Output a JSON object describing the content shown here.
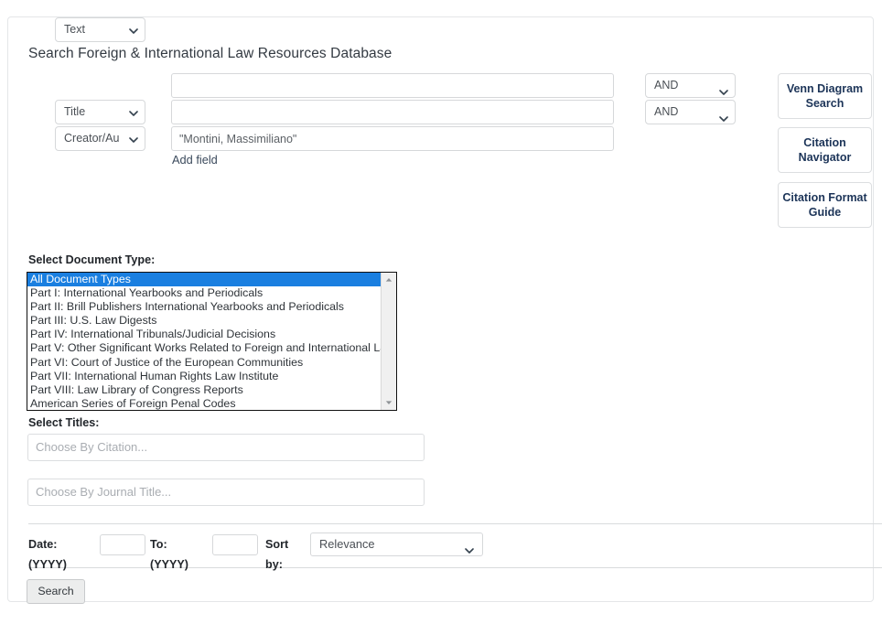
{
  "page": {
    "title": "Search Foreign & International Law Resources Database"
  },
  "search_rows": [
    {
      "field_label": "Text",
      "value": "",
      "boolean_label": "AND"
    },
    {
      "field_label": "Title",
      "value": "",
      "boolean_label": "AND"
    },
    {
      "field_label": "Creator/Au",
      "value": "\"Montini, Massimiliano\"",
      "boolean_label": ""
    }
  ],
  "add_field": {
    "label": "Add field"
  },
  "side_buttons": [
    {
      "label": "Venn Diagram Search"
    },
    {
      "label": "Citation Navigator"
    },
    {
      "label": "Citation Format Guide"
    }
  ],
  "document_type": {
    "label": "Select Document Type:",
    "selected": "All Document Types",
    "options": [
      "All Document Types",
      "Part I: International Yearbooks and Periodicals",
      "Part II: Brill Publishers International Yearbooks and Periodicals",
      "Part III: U.S. Law Digests",
      "Part IV: International Tribunals/Judicial Decisions",
      "Part V: Other Significant Works Related to Foreign and International Law",
      "Part VI: Court of Justice of the European Communities",
      "Part VII: International Human Rights Law Institute",
      "Part VIII: Law Library of Congress Reports",
      "American Series of Foreign Penal Codes"
    ]
  },
  "titles": {
    "label": "Select Titles:",
    "citation_placeholder": "Choose By Citation...",
    "journal_placeholder": "Choose By Journal Title..."
  },
  "date_row": {
    "date_label": "Date: (YYYY)",
    "date_value": "",
    "to_label": "To: (YYYY)",
    "to_value": "",
    "sort_label": "Sort by:",
    "sort_selected": "Relevance"
  },
  "search_button": {
    "label": "Search"
  },
  "colors": {
    "selection_blue": "#1a7fe0",
    "button_navy": "#1c3458",
    "link_slate": "#3b4a5c",
    "border_gray": "#d6d8da"
  }
}
